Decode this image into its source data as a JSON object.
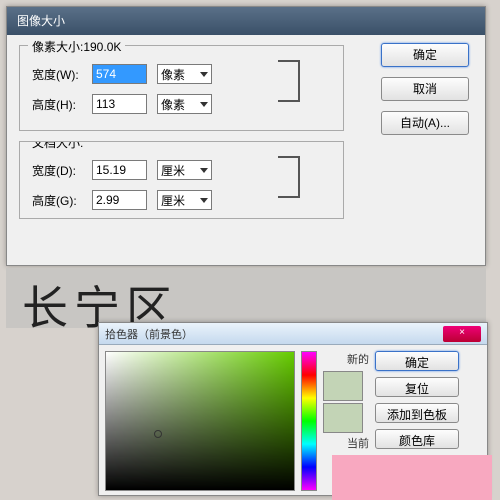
{
  "dlg1": {
    "title": "图像大小",
    "pixel_group": {
      "legend": "像素大小:190.0K",
      "width_label": "宽度(W):",
      "width_value": "574",
      "width_unit": "像素",
      "height_label": "高度(H):",
      "height_value": "113",
      "height_unit": "像素"
    },
    "doc_group": {
      "legend": "文档大小:",
      "width_label": "宽度(D):",
      "width_value": "15.19",
      "width_unit": "厘米",
      "height_label": "高度(G):",
      "height_value": "2.99",
      "height_unit": "厘米"
    },
    "buttons": {
      "ok": "确定",
      "cancel": "取消",
      "auto": "自动(A)..."
    }
  },
  "canvas_text": "长宁区",
  "dlg2": {
    "title": "拾色器（前景色）",
    "close": "×",
    "new_label": "新的",
    "current_label": "当前",
    "buttons": {
      "ok": "确定",
      "reset": "复位",
      "add": "添加到色板",
      "lib": "颜色库"
    },
    "swatch_new": "#c3d4b6",
    "swatch_cur": "#c3d4b6"
  }
}
